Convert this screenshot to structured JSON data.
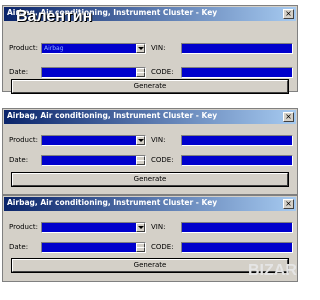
{
  "watermark": "Валентин",
  "brand": "BIZAR",
  "windows": [
    {
      "title": "Airbag, Air conditioning, Instrument Cluster - Key",
      "product_label": "Product:",
      "product_value": "Airbag",
      "vin_label": "VIN:",
      "vin_value": "",
      "date_label": "Date:",
      "date_value": "",
      "code_label": "CODE:",
      "code_value": "",
      "generate_label": "Generate"
    },
    {
      "title": "Airbag, Air conditioning, Instrument Cluster - Key",
      "product_label": "Product:",
      "product_value": "",
      "vin_label": "VIN:",
      "vin_value": "",
      "date_label": "Date:",
      "date_value": "",
      "code_label": "CODE:",
      "code_value": "",
      "generate_label": "Generate"
    },
    {
      "title": "Airbag, Air conditioning, Instrument Cluster - Key",
      "product_label": "Product:",
      "product_value": "",
      "vin_label": "VIN:",
      "vin_value": "",
      "date_label": "Date:",
      "date_value": "",
      "code_label": "CODE:",
      "code_value": "",
      "generate_label": "Generate"
    }
  ],
  "colors": {
    "field_bg": "#0000cc",
    "titlebar_start": "#0a246a",
    "titlebar_end": "#a6caf0",
    "window_bg": "#d4d0c8"
  },
  "icons": {
    "close": "close-icon",
    "dropdown": "chevron-down-icon",
    "spinner": "spinner-icon"
  }
}
